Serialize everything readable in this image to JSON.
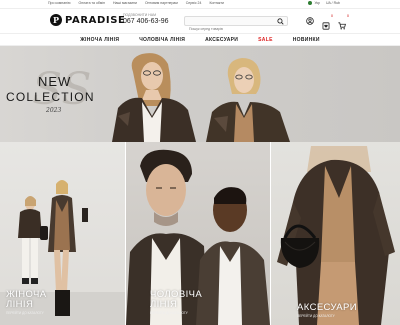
{
  "topbar": {
    "links": [
      "Про компанію",
      "Оплата та обмін",
      "Наші магазини",
      "Оптовим партнерам",
      "Сервіс 24",
      "Контакти"
    ],
    "lang": "Укр",
    "currency": "UA / Rub"
  },
  "header": {
    "logo_mark": "P",
    "logo_text": "PARADISE",
    "phone_caption": "ПОДЗВОНИТИ НАМ",
    "phone": "067 406-63-96",
    "search_placeholder": "Пошук серед товарів",
    "wishlist_count": "0",
    "cart_count": "0"
  },
  "nav": {
    "items": [
      "ЖІНОЧА ЛІНІЯ",
      "ЧОЛОВІЧА ЛІНІЯ",
      "АКСЕСУАРИ",
      "SALE",
      "НОВИНКИ"
    ]
  },
  "hero": {
    "monogram": "SS",
    "line1": "NEW",
    "line2": "COLLECTION",
    "year": "2023"
  },
  "tiles": [
    {
      "title": "ЖІНОЧА\nЛІНІЯ",
      "sub": "ПЕРЕЙТИ ДО КАТАЛОГУ"
    },
    {
      "title": "ЧОЛОВІЧА\nЛІНІЯ",
      "sub": "ПЕРЕЙТИ ДО КАТАЛОГУ"
    },
    {
      "title": "АКСЕСУАРИ",
      "sub": "ПЕРЕЙТИ ДО КАТАЛОГУ"
    }
  ],
  "colors": {
    "accent_sale": "#dd2222",
    "text_dark": "#111111",
    "leather": "#3b2f26"
  },
  "icons": [
    "search-icon",
    "user-icon",
    "heart-icon",
    "cart-icon"
  ]
}
